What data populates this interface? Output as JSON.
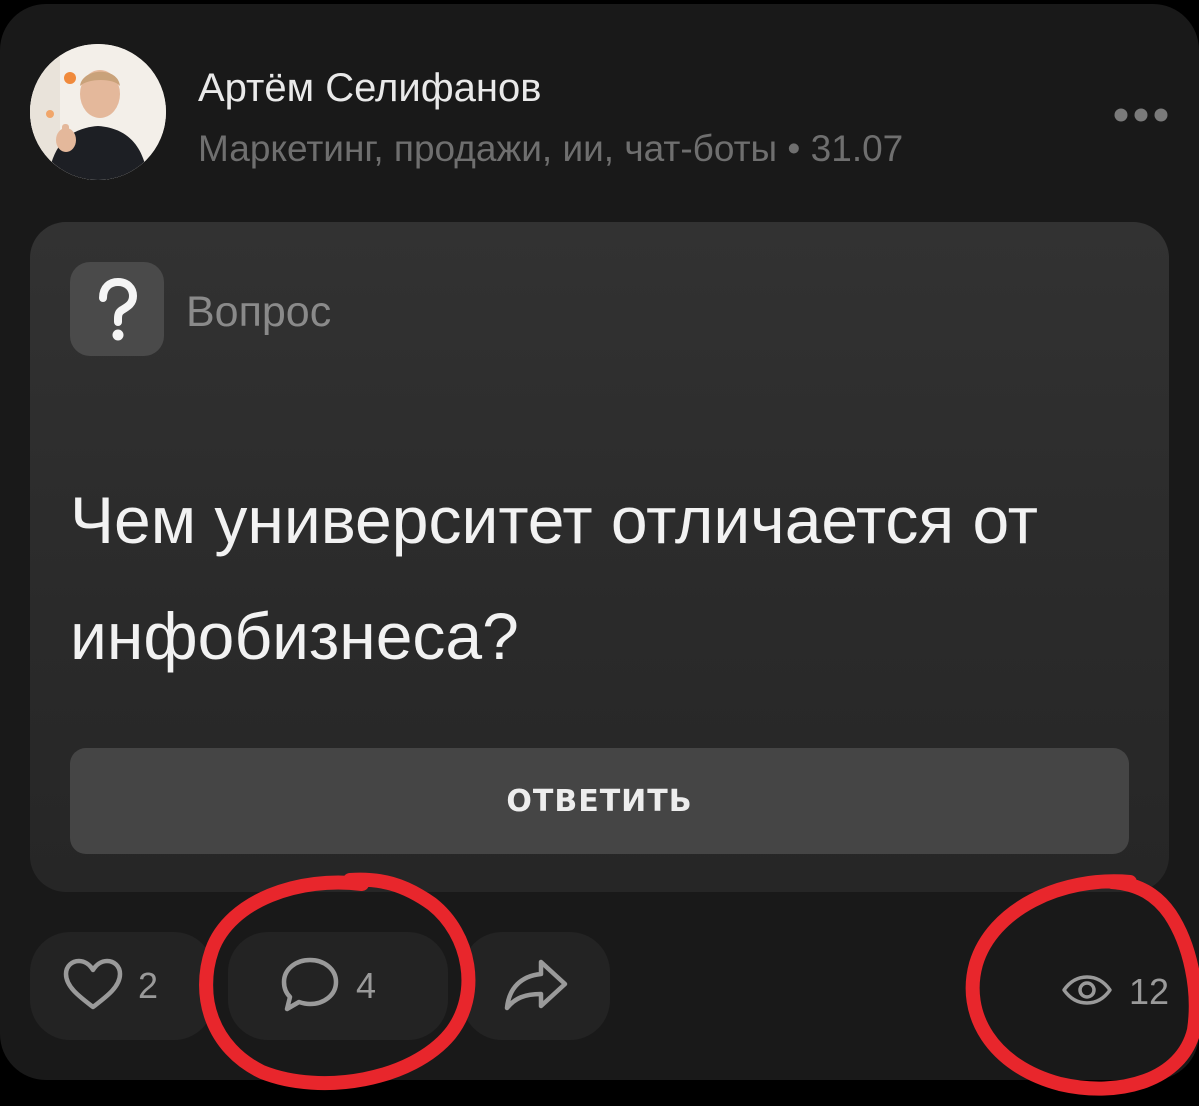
{
  "post": {
    "author": {
      "name": "Артём Селифанов",
      "meta": "Маркетинг, продажи, ии, чат-боты",
      "date": "31.07",
      "separator": " • "
    },
    "question": {
      "badge_glyph": "?",
      "label": "Вопрос",
      "text": "Чем университет отличается от инфобизнеса?",
      "answer_button_label": "ОТВЕТИТЬ"
    },
    "actions": {
      "likes": "2",
      "comments": "4",
      "views": "12"
    }
  },
  "icons": {
    "more": "more-horizontal-icon",
    "like": "heart-icon",
    "comment": "comment-bubble-icon",
    "share": "share-arrow-icon",
    "views": "eye-icon",
    "question": "question-mark-icon"
  },
  "colors": {
    "card_background": "#191919",
    "question_card": "#2e2e2e",
    "button": "#454545",
    "annotation": "#e8262c"
  }
}
